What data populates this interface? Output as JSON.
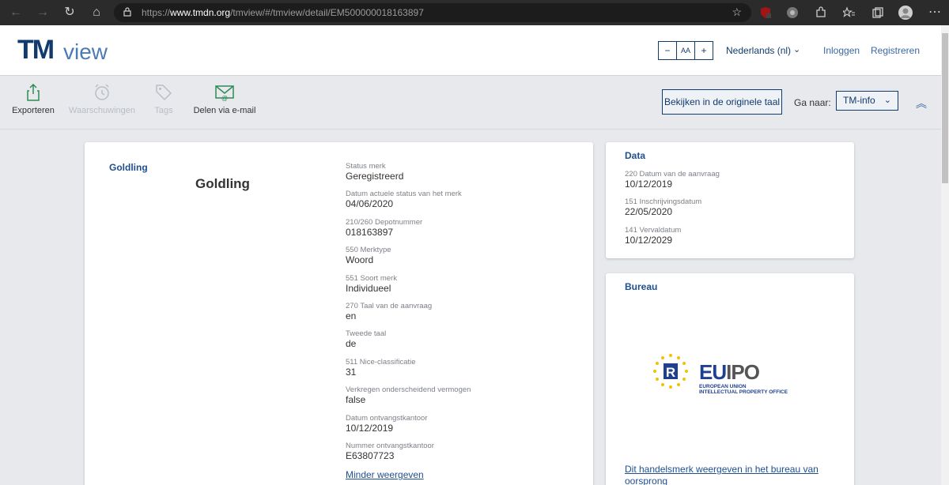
{
  "browser": {
    "url_prefix": "https://",
    "url_host": "www.tmdn.org",
    "url_path": "/tmview/#/tmview/detail/EM500000018163897"
  },
  "header": {
    "logo_tm": "TM",
    "logo_view": "view",
    "font_decrease": "−",
    "font_label": "AA",
    "font_increase": "+",
    "language": "Nederlands (nl)",
    "login": "Inloggen",
    "register": "Registreren"
  },
  "toolbar": {
    "export": "Exporteren",
    "alerts": "Waarschuwingen",
    "tags": "Tags",
    "share_email": "Delen via e-mail",
    "view_original": "Bekijken in de originele taal",
    "goto_label": "Ga naar:",
    "goto_value": "TM-info"
  },
  "main": {
    "mark_link": "Goldling",
    "mark_title": "Goldling",
    "fields": [
      {
        "label": "Status merk",
        "value": "Geregistreerd"
      },
      {
        "label": "Datum actuele status van het merk",
        "value": "04/06/2020"
      },
      {
        "label": "210/260 Depotnummer",
        "value": "018163897"
      },
      {
        "label": "550 Merktype",
        "value": "Woord"
      },
      {
        "label": "551 Soort merk",
        "value": "Individueel"
      },
      {
        "label": "270 Taal van de aanvraag",
        "value": "en"
      },
      {
        "label": "Tweede taal",
        "value": "de"
      },
      {
        "label": "511 Nice-classificatie",
        "value": "31"
      },
      {
        "label": "Verkregen onderscheidend vermogen",
        "value": "false"
      },
      {
        "label": "Datum ontvangstkantoor",
        "value": "10/12/2019"
      },
      {
        "label": "Nummer ontvangstkantoor",
        "value": "E63807723"
      }
    ],
    "show_less": "Minder weergeven"
  },
  "data_card": {
    "title": "Data",
    "fields": [
      {
        "label": "220 Datum van de aanvraag",
        "value": "10/12/2019"
      },
      {
        "label": "151 Inschrijvingsdatum",
        "value": "22/05/2020"
      },
      {
        "label": "141 Vervaldatum",
        "value": "10/12/2029"
      }
    ]
  },
  "bureau_card": {
    "title": "Bureau",
    "logo_eu": "EU",
    "logo_ipo": "IPO",
    "logo_line1": "EUROPEAN UNION",
    "logo_line2": "INTELLECTUAL PROPERTY OFFICE",
    "link": "Dit handelsmerk weergeven in het bureau van oorsprong"
  },
  "colors": {
    "brand_navy": "#123b6d",
    "link_blue": "#1f4f8f",
    "page_bg": "#e7e9ec"
  }
}
